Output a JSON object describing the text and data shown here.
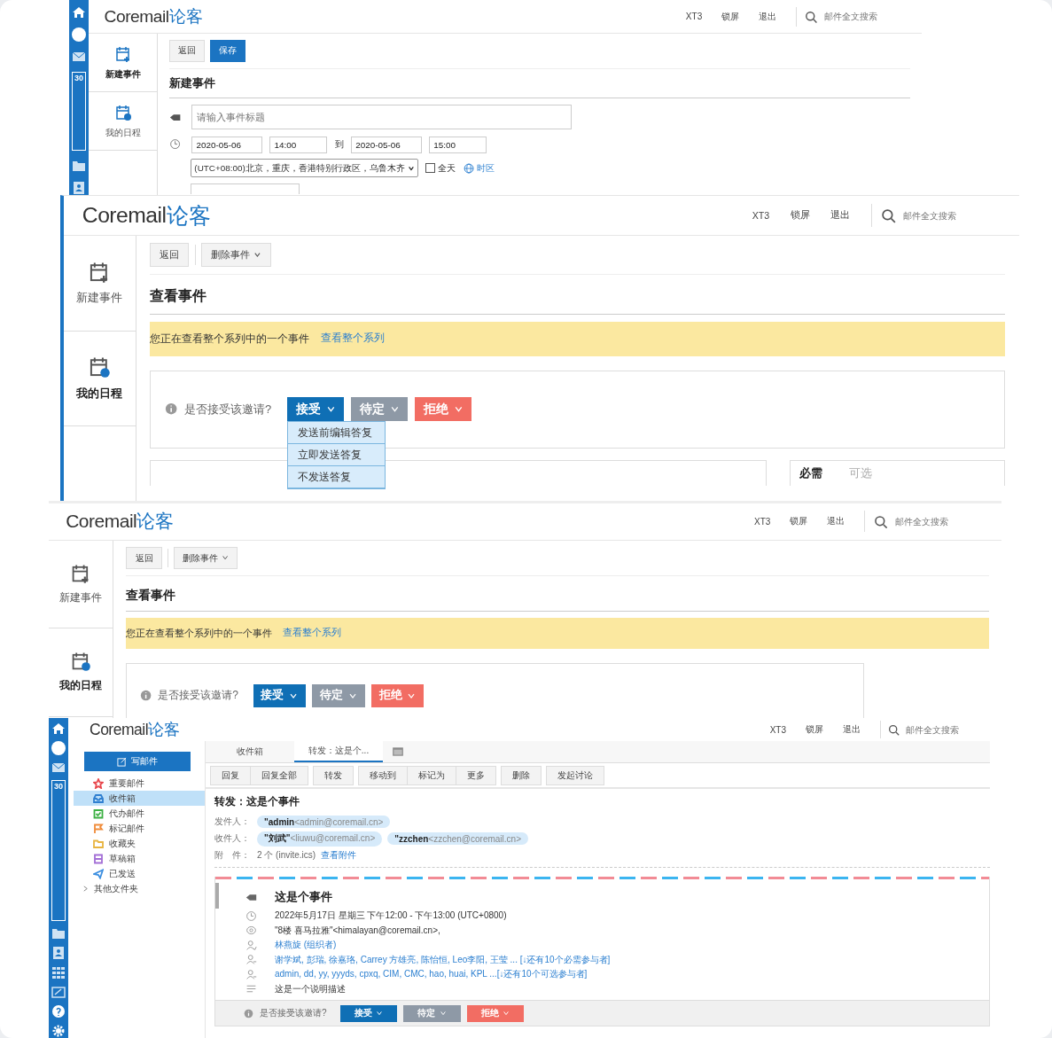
{
  "new_event_panel": {
    "rail": {
      "calendar_day": "30"
    },
    "header": {
      "brand": "Coremail",
      "brand_cn": "论客",
      "links": [
        "XT3",
        "锁屏",
        "退出"
      ],
      "search_placeholder": "邮件全文搜索"
    },
    "nav": [
      {
        "label": "新建事件",
        "selected": true
      },
      {
        "label": "我的日程",
        "selected": false
      }
    ],
    "toolbar": [
      {
        "label": "返回",
        "kind": "plain"
      },
      {
        "label": "保存",
        "kind": "primary"
      }
    ],
    "title": "新建事件",
    "form": {
      "title_placeholder": "请输入事件标题",
      "start_date": "2020-05-06",
      "start_time": "14:00",
      "to": "到",
      "end_date": "2020-05-06",
      "end_time": "15:00",
      "timezone": "(UTC+08:00)北京，重庆，香港特别行政区，乌鲁木齐",
      "all_day": {
        "label": "全天",
        "checked": false
      },
      "timezone_link": "时区"
    }
  },
  "view_event_panels": [
    {
      "header": {
        "brand": "Coremail",
        "brand_cn": "论客",
        "links": [
          "XT3",
          "锁屏",
          "退出"
        ],
        "search_placeholder": "邮件全文搜索"
      },
      "nav": [
        {
          "label": "新建事件",
          "selected": false
        },
        {
          "label": "我的日程",
          "selected": true
        }
      ],
      "toolbar": [
        {
          "label": "返回",
          "kind": "plain"
        },
        {
          "label": "删除事件",
          "kind": "dropdown"
        }
      ],
      "title": "查看事件",
      "notice": "您正在查看整个系列中的一个事件",
      "notice_link": "查看整个系列",
      "question": "是否接受该邀请?",
      "responses": [
        {
          "label": "接受",
          "kind": "accept"
        },
        {
          "label": "待定",
          "kind": "tentative"
        },
        {
          "label": "拒绝",
          "kind": "decline"
        }
      ],
      "menu": [
        "发送前编辑答复",
        "立即发送答复",
        "不发送答复"
      ],
      "attendee_tabs": [
        {
          "label": "必需",
          "selected": true
        },
        {
          "label": "可选",
          "selected": false
        }
      ]
    },
    {
      "header": {
        "brand": "Coremail",
        "brand_cn": "论客",
        "links": [
          "XT3",
          "锁屏",
          "退出"
        ],
        "search_placeholder": "邮件全文搜索"
      },
      "nav": [
        {
          "label": "新建事件",
          "selected": false
        },
        {
          "label": "我的日程",
          "selected": true
        }
      ],
      "toolbar": [
        {
          "label": "返回",
          "kind": "plain"
        },
        {
          "label": "删除事件",
          "kind": "dropdown"
        }
      ],
      "title": "查看事件",
      "notice": "您正在查看整个系列中的一个事件",
      "notice_link": "查看整个系列",
      "question": "是否接受该邀请?",
      "responses": [
        {
          "label": "接受",
          "kind": "accept"
        },
        {
          "label": "待定",
          "kind": "tentative"
        },
        {
          "label": "拒绝",
          "kind": "decline"
        }
      ]
    }
  ],
  "mail_panel": {
    "rail": {
      "calendar_day": "30"
    },
    "header": {
      "brand": "Coremail",
      "brand_cn": "论客",
      "links": [
        "XT3",
        "锁屏",
        "退出"
      ],
      "search_placeholder": "邮件全文搜索"
    },
    "compose": "写邮件",
    "folders": [
      {
        "label": "重要邮件",
        "kind": "star",
        "color": "#e8474c",
        "selected": false
      },
      {
        "label": "收件箱",
        "kind": "inbox",
        "color": "#2f7fd0",
        "selected": true
      },
      {
        "label": "代办邮件",
        "kind": "todo",
        "color": "#3cb043",
        "selected": false
      },
      {
        "label": "标记邮件",
        "kind": "flag",
        "color": "#f08c3a",
        "selected": false
      },
      {
        "label": "收藏夹",
        "kind": "folder",
        "color": "#e8b440",
        "selected": false
      },
      {
        "label": "草稿箱",
        "kind": "draft",
        "color": "#a36fd6",
        "selected": false
      },
      {
        "label": "已发送",
        "kind": "sent",
        "color": "#3d8fe0",
        "selected": false
      }
    ],
    "other_folders": {
      "label": "其他文件夹",
      "expanded": false
    },
    "tabs": [
      {
        "label": "收件箱",
        "selected": false
      },
      {
        "label": "转发：这是个...",
        "selected": true
      }
    ],
    "toolbar": [
      [
        "回复",
        "回复全部"
      ],
      [
        "转发"
      ],
      [
        "移动到",
        "标记为",
        "更多"
      ],
      [
        "删除"
      ],
      [
        "发起讨论"
      ]
    ],
    "subject": "转发：这是个事件",
    "from": {
      "label": "发件人：",
      "chips": [
        {
          "name": "\"admin",
          "email": "<admin@coremail.cn>"
        }
      ]
    },
    "to": {
      "label": "收件人：",
      "chips": [
        {
          "name": "\"刘武\"",
          "email": "<liuwu@coremail.cn>"
        },
        {
          "name": "\"zzchen",
          "email": "<zzchen@coremail.cn>"
        }
      ]
    },
    "attachment": {
      "label": "附　件：",
      "text": "2 个 (invite.ics)",
      "link": "查看附件"
    },
    "event": {
      "title": "这是个事件",
      "rows": [
        {
          "kind": "time",
          "text": "2022年5月17日 星期三 下午12:00 - 下午13:00 (UTC+0800)"
        },
        {
          "kind": "location",
          "text": "\"8楼 喜马拉雅\"<himalayan@coremail.cn>,"
        },
        {
          "kind": "organizer",
          "text": "林燕旋 (组织者)"
        },
        {
          "kind": "required",
          "text": "谢学斌, 彭瑞, 徐嘉珞, Carrey 方雄亮, 陈怡恒, Leo李阳, 王莹 ... [↓还有10个必需参与者]"
        },
        {
          "kind": "optional",
          "text": "admin, dd, yy, yyyds, cpxq, CIM, CMC, hao, huai, KPL ...[↓还有10个可选参与者]"
        },
        {
          "kind": "description",
          "text": "这是一个说明描述"
        }
      ],
      "question": "是否接受该邀请?",
      "responses": [
        {
          "label": "接受",
          "kind": "accept"
        },
        {
          "label": "待定",
          "kind": "tentative"
        },
        {
          "label": "拒绝",
          "kind": "decline"
        }
      ]
    }
  }
}
